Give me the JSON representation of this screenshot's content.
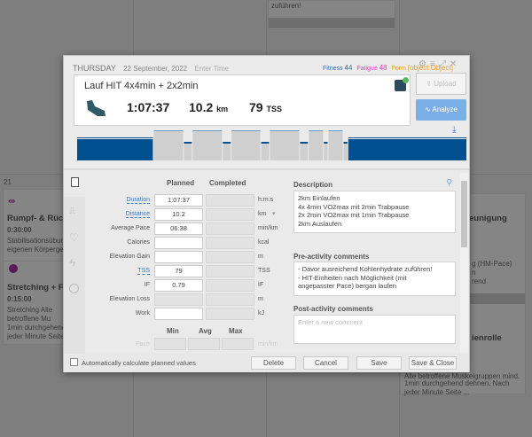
{
  "background": {
    "day_number": "21",
    "top_card_text": "zuführen!",
    "cards_left": [
      {
        "title": "Rumpf- & Rüc",
        "duration": "0:30:00",
        "text": "Stabilisationsübun eigenen Körperge",
        "icon": "dumbbell-icon"
      },
      {
        "title": "Stretching + Fa",
        "duration": "0:15:00",
        "text": "Stretching Alle betroffene Mu 1min durchgehend jeder Minute Seite",
        "icon": "stopwatch-icon"
      }
    ],
    "cards_right": [
      {
        "title": "schleunigung",
        "lines": [
          "g (HM-Pace)",
          "n",
          "rend"
        ]
      },
      {
        "title": "ienrolle",
        "lines": [
          "Alle betroffene Muskelgruppen mind.",
          "1min durchgehend dehnen. Nach",
          "jeder Minute Seite ..."
        ]
      }
    ]
  },
  "modal": {
    "day": "THURSDAY",
    "date": "22 September, 2022",
    "enter_time": "Enter Time",
    "fitness_label": "Fitness",
    "fitness": "44",
    "fatigue_label": "Fatigue",
    "fatigue": "48",
    "form_label": "Form",
    "form": {
      "planned_header": "Planned",
      "completed_header": "Completed",
      "rows": [
        {
          "label": "Duration",
          "planned": "1:07:37",
          "unit": "h:m:s",
          "link": true
        },
        {
          "label": "Distance",
          "planned": "10.2",
          "unit": "km",
          "link": true
        },
        {
          "label": "Average Pace",
          "planned": "06:38",
          "unit": "min/km"
        },
        {
          "label": "Calories",
          "planned": "",
          "unit": "kcal"
        },
        {
          "label": "Elevation Gain",
          "planned": "",
          "unit": "m"
        },
        {
          "label": "TSS",
          "planned": "79",
          "unit": "TSS",
          "link": true
        },
        {
          "label": "IF",
          "planned": "0.79",
          "unit": "IF"
        },
        {
          "label": "Elevation Loss",
          "planned": "",
          "unit": "m",
          "disabled": true
        },
        {
          "label": "Work",
          "planned": "",
          "unit": "kJ"
        }
      ],
      "min_header": "Min",
      "avg_header": "Avg",
      "max_header": "Max",
      "pace_label": "Pace",
      "pace_unit": "min/km"
    },
    "colors": {
      "fitness": "#3a6fa8",
      "fatigue": "#e040c8",
      "form": "#f0a020",
      "accent": "#7aaee6",
      "chart": "#00508f"
    },
    "workout_title": "Lauf HIT 4x4min + 2x2min",
    "sport_icon": "running-shoe-icon",
    "duration": "1:07:37",
    "distance": "10.2",
    "distance_unit": "km",
    "tss": "79",
    "tss_unit": "TSS",
    "upload_label": "Upload",
    "analyze_label": "Analyze",
    "workout_structure": [
      {
        "type": "warmup",
        "minutes": 13.2
      },
      {
        "type": "interval",
        "minutes": 5.2
      },
      {
        "type": "recovery",
        "minutes": 1.5
      },
      {
        "type": "interval",
        "minutes": 5.2
      },
      {
        "type": "recovery",
        "minutes": 1.5
      },
      {
        "type": "interval",
        "minutes": 5.1
      },
      {
        "type": "recovery",
        "minutes": 1.5
      },
      {
        "type": "interval",
        "minutes": 5.2
      },
      {
        "type": "recovery",
        "minutes": 1.5
      },
      {
        "type": "interval",
        "minutes": 2.6
      },
      {
        "type": "recovery",
        "minutes": 0.8
      },
      {
        "type": "interval",
        "minutes": 2.6
      },
      {
        "type": "recovery",
        "minutes": 0.8
      },
      {
        "type": "cooldown",
        "minutes": 20.5
      }
    ],
    "description_label": "Description",
    "description": [
      "2km Einlaufen",
      "4x 4min VO2max mit 2min Trabpause",
      "2x 2min VO2max mit 1min Trabpause",
      "2km Auslaufen"
    ],
    "pre_label": "Pre-activity comments",
    "pre_comments": [
      "- Davor ausreichend Kohlenhydrate zuführen!",
      "- HIT-Einheiten nach Möglichkeit (mit",
      "angepasster Pace) bergan laufen"
    ],
    "post_label": "Post-activity comments",
    "post_placeholder": "Enter a new comment",
    "auto_calc_label": "Automatically calculate planned values",
    "auto_calc_checked": false,
    "delete_label": "Delete",
    "cancel_label": "Cancel",
    "save_label": "Save",
    "save_close_label": "Save & Close"
  }
}
